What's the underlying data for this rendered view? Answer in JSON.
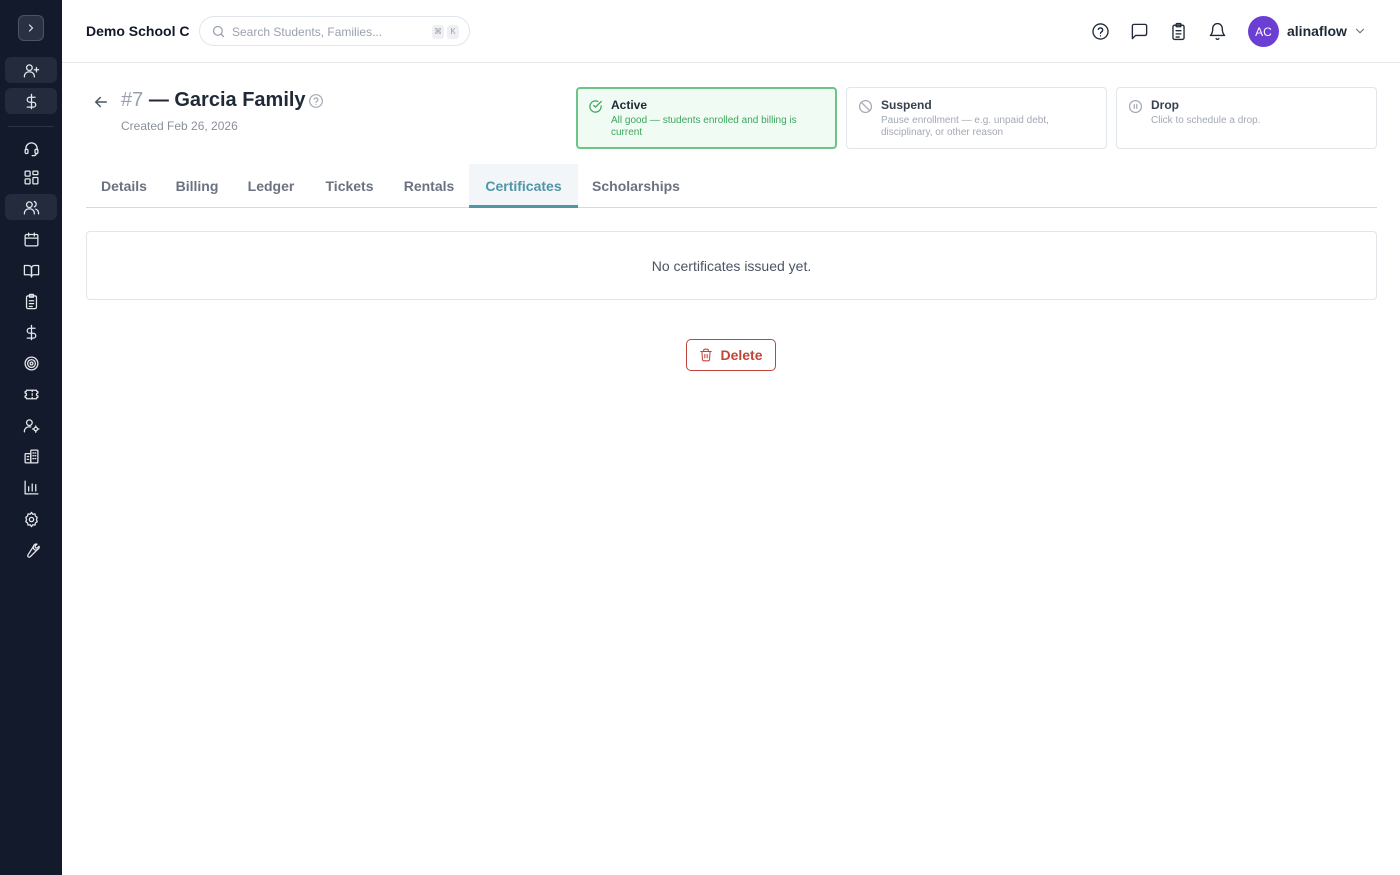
{
  "topbar": {
    "school_name": "Demo School C",
    "search": {
      "placeholder": "Search Students, Families...",
      "kbd_1": "⌘",
      "kbd_2": "K"
    },
    "user": {
      "initials": "AC",
      "name": "alinaflow"
    }
  },
  "sidebar": {
    "items": [
      {
        "icon": "user-plus-icon"
      },
      {
        "icon": "dollar-icon"
      },
      {
        "icon": "headset-icon"
      },
      {
        "icon": "dashboard-icon"
      },
      {
        "icon": "users-icon",
        "active": true
      },
      {
        "icon": "calendar-icon"
      },
      {
        "icon": "book-icon"
      },
      {
        "icon": "clipboard-icon"
      },
      {
        "icon": "dollar-icon"
      },
      {
        "icon": "target-icon"
      },
      {
        "icon": "ticket-icon"
      },
      {
        "icon": "user-cog-icon"
      },
      {
        "icon": "building-icon"
      },
      {
        "icon": "bar-chart-icon"
      },
      {
        "icon": "gear-icon"
      },
      {
        "icon": "wrench-icon"
      }
    ]
  },
  "page": {
    "number": "#7",
    "title": "— Garcia Family",
    "created": "Created Feb 26, 2026"
  },
  "statuses": [
    {
      "title": "Active",
      "description": "All good — students enrolled and billing is current",
      "selected": true
    },
    {
      "title": "Suspend",
      "description": "Pause enrollment — e.g. unpaid debt, disciplinary, or other reason",
      "selected": false
    },
    {
      "title": "Drop",
      "description": "Click to schedule a drop.",
      "selected": false
    }
  ],
  "tabs": [
    {
      "label": "Details"
    },
    {
      "label": "Billing"
    },
    {
      "label": "Ledger"
    },
    {
      "label": "Tickets"
    },
    {
      "label": "Rentals"
    },
    {
      "label": "Certificates",
      "active": true
    },
    {
      "label": "Scholarships"
    }
  ],
  "content": {
    "empty_message": "No certificates issued yet.",
    "delete_label": "Delete"
  },
  "colors": {
    "sidebar_bg": "#131a2c",
    "accent": "#4f97a8",
    "active_green": "#3ea65f",
    "danger": "#c0453b",
    "avatar": "#6b3fd4"
  }
}
